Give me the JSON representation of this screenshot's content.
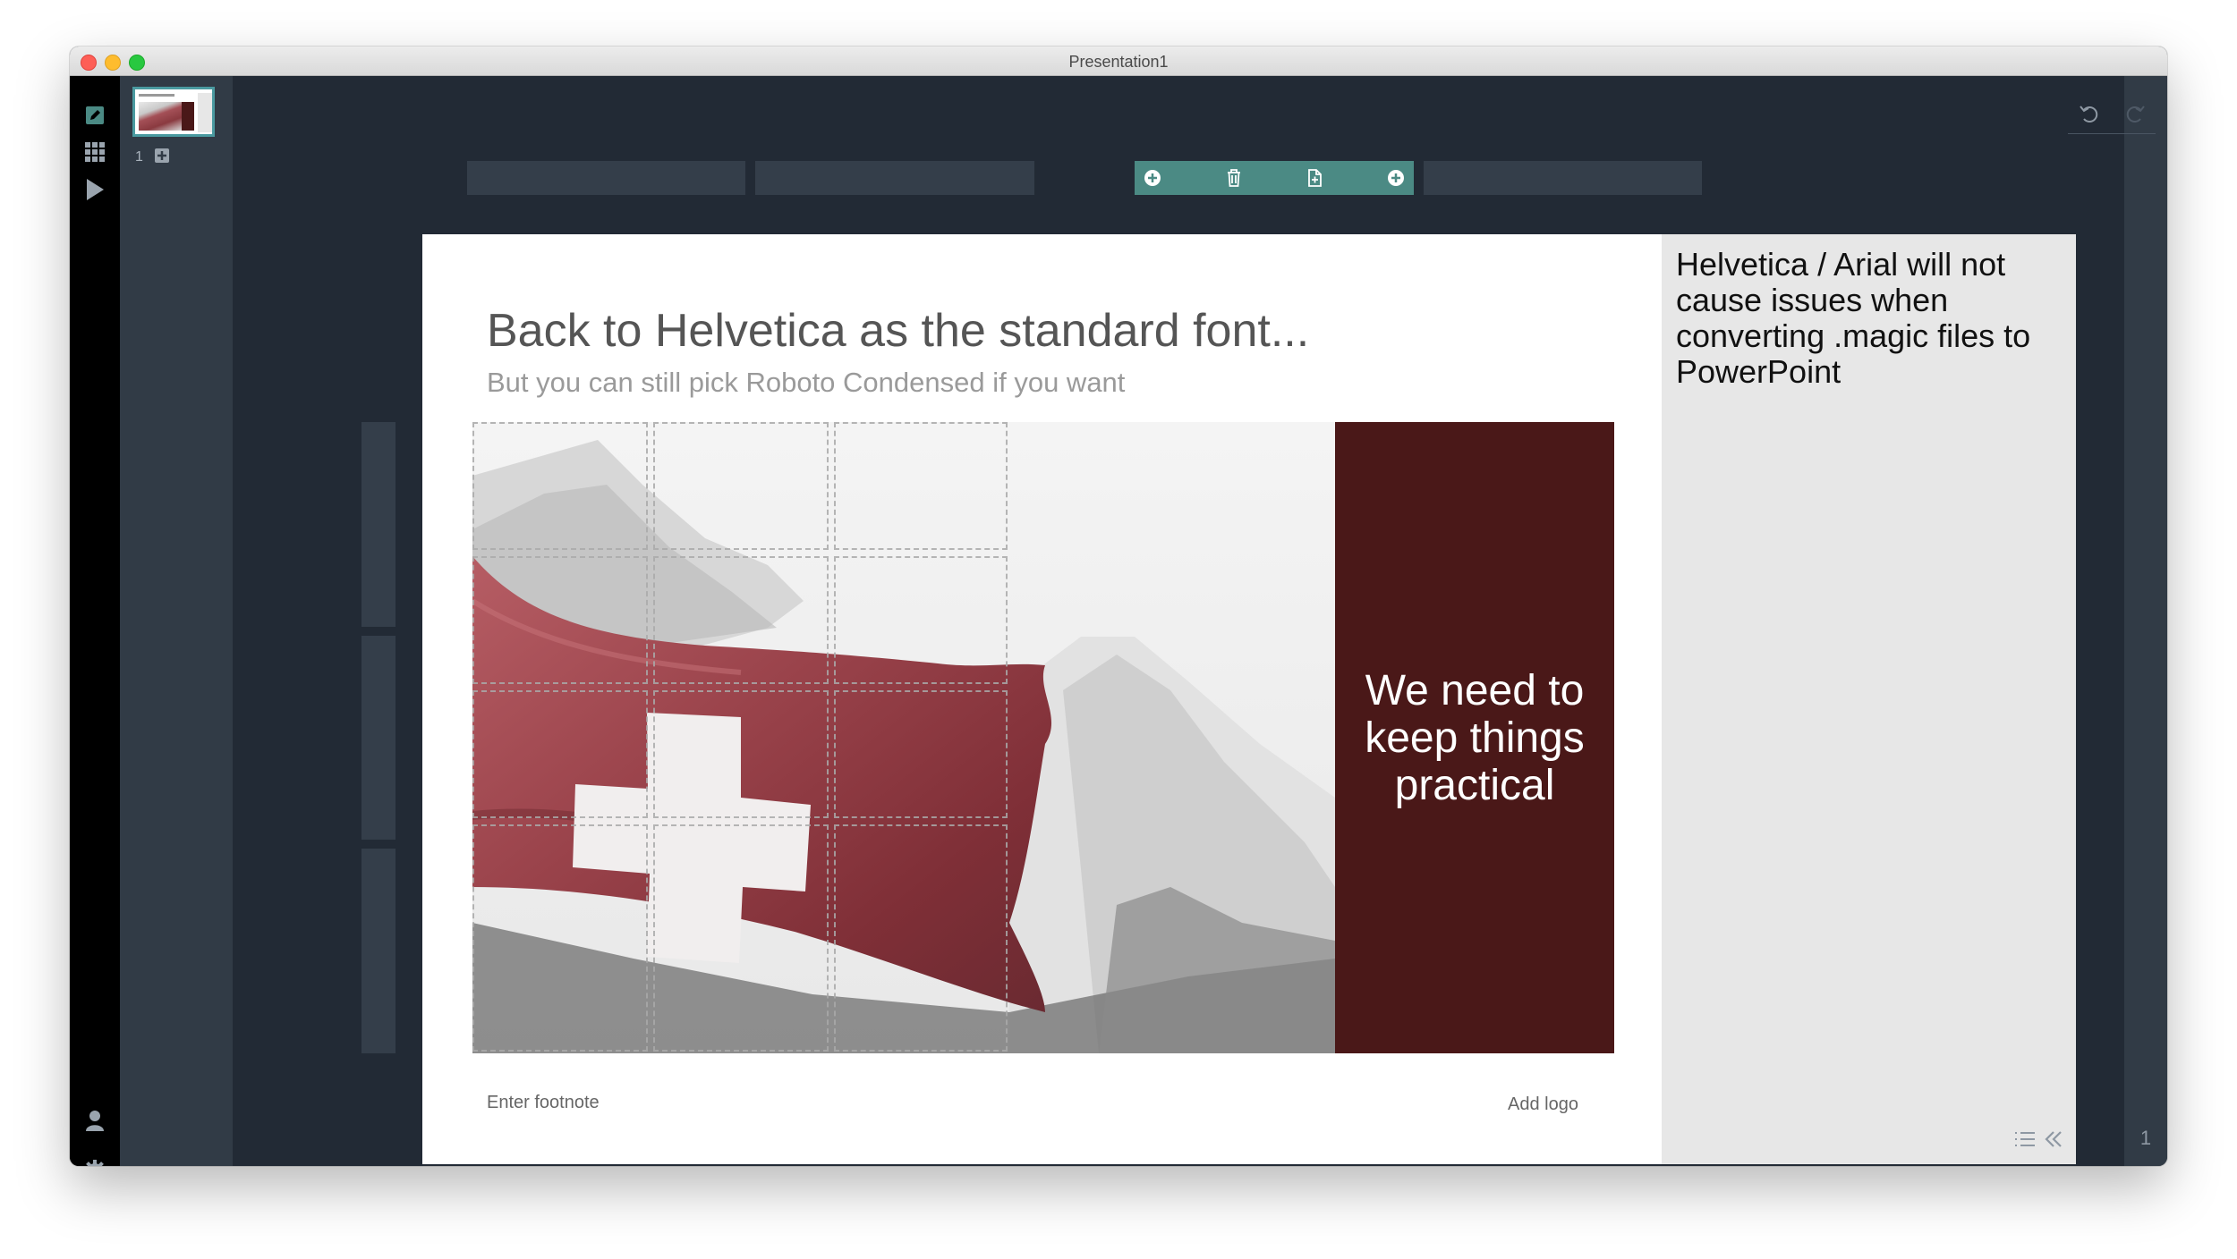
{
  "window": {
    "title": "Presentation1"
  },
  "thumbnails": {
    "slide_number": "1"
  },
  "slide": {
    "title": "Back to Helvetica as the standard font...",
    "subtitle": "But you can still pick Roboto Condensed if you want",
    "callout_text": "We need to keep things practical",
    "footnote_placeholder": "Enter footnote",
    "logo_placeholder": "Add logo"
  },
  "notes": {
    "text": "Helvetica / Arial will not cause issues when converting .magic files to PowerPoint"
  },
  "page_counter": "1",
  "colors": {
    "callout_background": "#4a1818",
    "accent_toolbar": "#4b8a84",
    "canvas_background": "#222a35",
    "notes_background": "#e7e7e7"
  },
  "icons": {
    "left_sidebar": [
      "edit-icon",
      "grid-icon",
      "play-icon",
      "user-icon",
      "settings-icon"
    ],
    "toolbar": [
      "add-left-icon",
      "trash-icon",
      "duplicate-icon",
      "add-right-icon"
    ],
    "bottom": [
      "list-icon",
      "collapse-icon"
    ],
    "top_right": [
      "undo-icon",
      "redo-icon"
    ]
  }
}
